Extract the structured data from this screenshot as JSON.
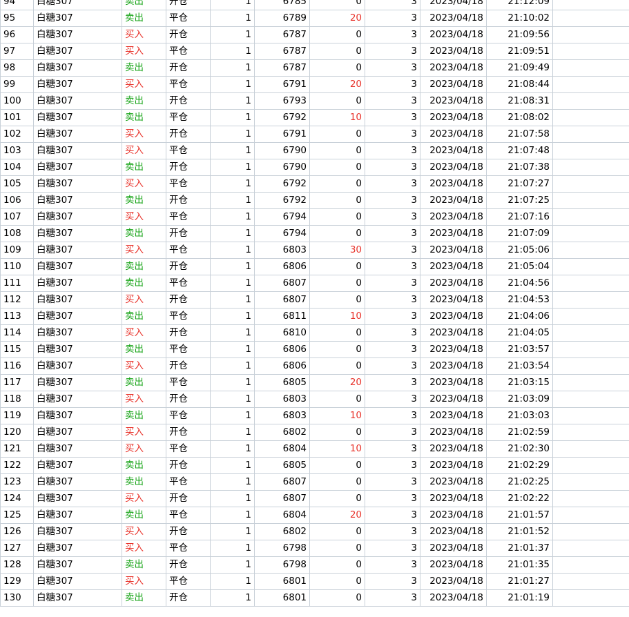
{
  "colors": {
    "buy": "#e8332b",
    "sell": "#16a316",
    "profit": "#e8332b",
    "grid": "#c8d0d8"
  },
  "rows": [
    {
      "idx": "94",
      "sym": "白糖307",
      "dir": "卖出",
      "off": "开仓",
      "qty": "1",
      "price": "6785",
      "pnl": "0",
      "fee": "3",
      "date": "2023/04/18",
      "time": "21:12:09"
    },
    {
      "idx": "95",
      "sym": "白糖307",
      "dir": "卖出",
      "off": "平仓",
      "qty": "1",
      "price": "6789",
      "pnl": "20",
      "fee": "3",
      "date": "2023/04/18",
      "time": "21:10:02"
    },
    {
      "idx": "96",
      "sym": "白糖307",
      "dir": "买入",
      "off": "开仓",
      "qty": "1",
      "price": "6787",
      "pnl": "0",
      "fee": "3",
      "date": "2023/04/18",
      "time": "21:09:56"
    },
    {
      "idx": "97",
      "sym": "白糖307",
      "dir": "买入",
      "off": "平仓",
      "qty": "1",
      "price": "6787",
      "pnl": "0",
      "fee": "3",
      "date": "2023/04/18",
      "time": "21:09:51"
    },
    {
      "idx": "98",
      "sym": "白糖307",
      "dir": "卖出",
      "off": "开仓",
      "qty": "1",
      "price": "6787",
      "pnl": "0",
      "fee": "3",
      "date": "2023/04/18",
      "time": "21:09:49"
    },
    {
      "idx": "99",
      "sym": "白糖307",
      "dir": "买入",
      "off": "平仓",
      "qty": "1",
      "price": "6791",
      "pnl": "20",
      "fee": "3",
      "date": "2023/04/18",
      "time": "21:08:44"
    },
    {
      "idx": "100",
      "sym": "白糖307",
      "dir": "卖出",
      "off": "开仓",
      "qty": "1",
      "price": "6793",
      "pnl": "0",
      "fee": "3",
      "date": "2023/04/18",
      "time": "21:08:31"
    },
    {
      "idx": "101",
      "sym": "白糖307",
      "dir": "卖出",
      "off": "平仓",
      "qty": "1",
      "price": "6792",
      "pnl": "10",
      "fee": "3",
      "date": "2023/04/18",
      "time": "21:08:02"
    },
    {
      "idx": "102",
      "sym": "白糖307",
      "dir": "买入",
      "off": "开仓",
      "qty": "1",
      "price": "6791",
      "pnl": "0",
      "fee": "3",
      "date": "2023/04/18",
      "time": "21:07:58"
    },
    {
      "idx": "103",
      "sym": "白糖307",
      "dir": "买入",
      "off": "平仓",
      "qty": "1",
      "price": "6790",
      "pnl": "0",
      "fee": "3",
      "date": "2023/04/18",
      "time": "21:07:48"
    },
    {
      "idx": "104",
      "sym": "白糖307",
      "dir": "卖出",
      "off": "开仓",
      "qty": "1",
      "price": "6790",
      "pnl": "0",
      "fee": "3",
      "date": "2023/04/18",
      "time": "21:07:38"
    },
    {
      "idx": "105",
      "sym": "白糖307",
      "dir": "买入",
      "off": "平仓",
      "qty": "1",
      "price": "6792",
      "pnl": "0",
      "fee": "3",
      "date": "2023/04/18",
      "time": "21:07:27"
    },
    {
      "idx": "106",
      "sym": "白糖307",
      "dir": "卖出",
      "off": "开仓",
      "qty": "1",
      "price": "6792",
      "pnl": "0",
      "fee": "3",
      "date": "2023/04/18",
      "time": "21:07:25"
    },
    {
      "idx": "107",
      "sym": "白糖307",
      "dir": "买入",
      "off": "平仓",
      "qty": "1",
      "price": "6794",
      "pnl": "0",
      "fee": "3",
      "date": "2023/04/18",
      "time": "21:07:16"
    },
    {
      "idx": "108",
      "sym": "白糖307",
      "dir": "卖出",
      "off": "开仓",
      "qty": "1",
      "price": "6794",
      "pnl": "0",
      "fee": "3",
      "date": "2023/04/18",
      "time": "21:07:09"
    },
    {
      "idx": "109",
      "sym": "白糖307",
      "dir": "买入",
      "off": "平仓",
      "qty": "1",
      "price": "6803",
      "pnl": "30",
      "fee": "3",
      "date": "2023/04/18",
      "time": "21:05:06"
    },
    {
      "idx": "110",
      "sym": "白糖307",
      "dir": "卖出",
      "off": "开仓",
      "qty": "1",
      "price": "6806",
      "pnl": "0",
      "fee": "3",
      "date": "2023/04/18",
      "time": "21:05:04"
    },
    {
      "idx": "111",
      "sym": "白糖307",
      "dir": "卖出",
      "off": "平仓",
      "qty": "1",
      "price": "6807",
      "pnl": "0",
      "fee": "3",
      "date": "2023/04/18",
      "time": "21:04:56"
    },
    {
      "idx": "112",
      "sym": "白糖307",
      "dir": "买入",
      "off": "开仓",
      "qty": "1",
      "price": "6807",
      "pnl": "0",
      "fee": "3",
      "date": "2023/04/18",
      "time": "21:04:53"
    },
    {
      "idx": "113",
      "sym": "白糖307",
      "dir": "卖出",
      "off": "平仓",
      "qty": "1",
      "price": "6811",
      "pnl": "10",
      "fee": "3",
      "date": "2023/04/18",
      "time": "21:04:06"
    },
    {
      "idx": "114",
      "sym": "白糖307",
      "dir": "买入",
      "off": "开仓",
      "qty": "1",
      "price": "6810",
      "pnl": "0",
      "fee": "3",
      "date": "2023/04/18",
      "time": "21:04:05"
    },
    {
      "idx": "115",
      "sym": "白糖307",
      "dir": "卖出",
      "off": "平仓",
      "qty": "1",
      "price": "6806",
      "pnl": "0",
      "fee": "3",
      "date": "2023/04/18",
      "time": "21:03:57"
    },
    {
      "idx": "116",
      "sym": "白糖307",
      "dir": "买入",
      "off": "开仓",
      "qty": "1",
      "price": "6806",
      "pnl": "0",
      "fee": "3",
      "date": "2023/04/18",
      "time": "21:03:54"
    },
    {
      "idx": "117",
      "sym": "白糖307",
      "dir": "卖出",
      "off": "平仓",
      "qty": "1",
      "price": "6805",
      "pnl": "20",
      "fee": "3",
      "date": "2023/04/18",
      "time": "21:03:15"
    },
    {
      "idx": "118",
      "sym": "白糖307",
      "dir": "买入",
      "off": "开仓",
      "qty": "1",
      "price": "6803",
      "pnl": "0",
      "fee": "3",
      "date": "2023/04/18",
      "time": "21:03:09"
    },
    {
      "idx": "119",
      "sym": "白糖307",
      "dir": "卖出",
      "off": "平仓",
      "qty": "1",
      "price": "6803",
      "pnl": "10",
      "fee": "3",
      "date": "2023/04/18",
      "time": "21:03:03"
    },
    {
      "idx": "120",
      "sym": "白糖307",
      "dir": "买入",
      "off": "开仓",
      "qty": "1",
      "price": "6802",
      "pnl": "0",
      "fee": "3",
      "date": "2023/04/18",
      "time": "21:02:59"
    },
    {
      "idx": "121",
      "sym": "白糖307",
      "dir": "买入",
      "off": "平仓",
      "qty": "1",
      "price": "6804",
      "pnl": "10",
      "fee": "3",
      "date": "2023/04/18",
      "time": "21:02:30"
    },
    {
      "idx": "122",
      "sym": "白糖307",
      "dir": "卖出",
      "off": "开仓",
      "qty": "1",
      "price": "6805",
      "pnl": "0",
      "fee": "3",
      "date": "2023/04/18",
      "time": "21:02:29"
    },
    {
      "idx": "123",
      "sym": "白糖307",
      "dir": "卖出",
      "off": "平仓",
      "qty": "1",
      "price": "6807",
      "pnl": "0",
      "fee": "3",
      "date": "2023/04/18",
      "time": "21:02:25"
    },
    {
      "idx": "124",
      "sym": "白糖307",
      "dir": "买入",
      "off": "开仓",
      "qty": "1",
      "price": "6807",
      "pnl": "0",
      "fee": "3",
      "date": "2023/04/18",
      "time": "21:02:22"
    },
    {
      "idx": "125",
      "sym": "白糖307",
      "dir": "卖出",
      "off": "平仓",
      "qty": "1",
      "price": "6804",
      "pnl": "20",
      "fee": "3",
      "date": "2023/04/18",
      "time": "21:01:57"
    },
    {
      "idx": "126",
      "sym": "白糖307",
      "dir": "买入",
      "off": "开仓",
      "qty": "1",
      "price": "6802",
      "pnl": "0",
      "fee": "3",
      "date": "2023/04/18",
      "time": "21:01:52"
    },
    {
      "idx": "127",
      "sym": "白糖307",
      "dir": "买入",
      "off": "平仓",
      "qty": "1",
      "price": "6798",
      "pnl": "0",
      "fee": "3",
      "date": "2023/04/18",
      "time": "21:01:37"
    },
    {
      "idx": "128",
      "sym": "白糖307",
      "dir": "卖出",
      "off": "开仓",
      "qty": "1",
      "price": "6798",
      "pnl": "0",
      "fee": "3",
      "date": "2023/04/18",
      "time": "21:01:35"
    },
    {
      "idx": "129",
      "sym": "白糖307",
      "dir": "买入",
      "off": "平仓",
      "qty": "1",
      "price": "6801",
      "pnl": "0",
      "fee": "3",
      "date": "2023/04/18",
      "time": "21:01:27"
    },
    {
      "idx": "130",
      "sym": "白糖307",
      "dir": "卖出",
      "off": "开仓",
      "qty": "1",
      "price": "6801",
      "pnl": "0",
      "fee": "3",
      "date": "2023/04/18",
      "time": "21:01:19"
    }
  ]
}
